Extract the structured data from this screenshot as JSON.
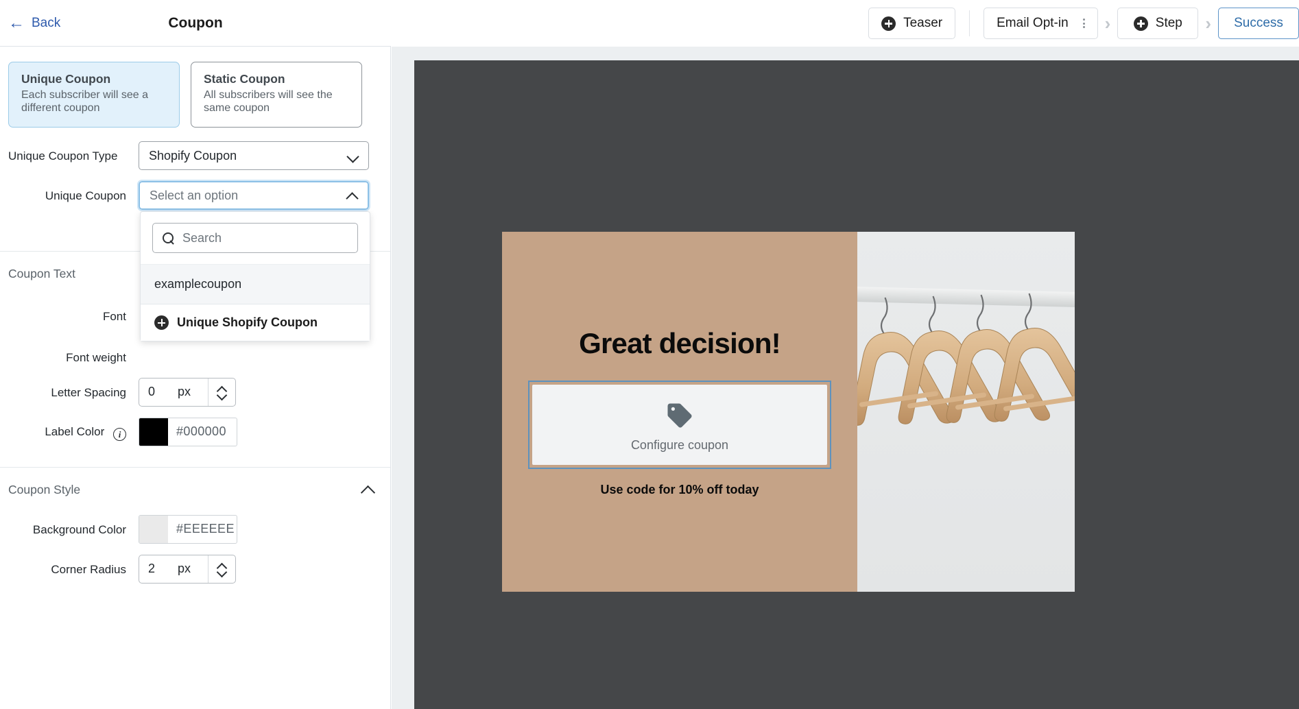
{
  "topbar": {
    "back_label": "Back",
    "panel_title": "Coupon",
    "steps": [
      {
        "label": "Teaser",
        "icon": "plus-circle-icon",
        "active": false,
        "kebab": false
      },
      {
        "label": "Email Opt-in",
        "icon": null,
        "active": false,
        "kebab": true
      },
      {
        "label": "Step",
        "icon": "plus-circle-icon",
        "active": false,
        "kebab": false
      },
      {
        "label": "Success",
        "icon": null,
        "active": true,
        "kebab": false
      }
    ]
  },
  "coupon_type": {
    "options": [
      {
        "title": "Unique Coupon",
        "desc": "Each subscriber will see a different coupon",
        "selected": true
      },
      {
        "title": "Static Coupon",
        "desc": "All subscribers will see the same coupon",
        "selected": false
      }
    ]
  },
  "fields": {
    "unique_coupon_type": {
      "label": "Unique Coupon Type",
      "value": "Shopify Coupon"
    },
    "unique_coupon": {
      "label": "Unique Coupon",
      "placeholder": "Select an option"
    }
  },
  "dropdown": {
    "search_placeholder": "Search",
    "search_icon": "search-icon",
    "options": [
      "examplecoupon"
    ],
    "action": {
      "label": "Unique Shopify Coupon",
      "icon": "plus-circle-icon"
    }
  },
  "coupon_text": {
    "section_title": "Coupon Text",
    "font_label": "Font",
    "font_weight_label": "Font weight",
    "letter_spacing": {
      "label": "Letter Spacing",
      "value": "0",
      "unit": "px"
    },
    "label_color": {
      "label": "Label Color",
      "hex": "#000000",
      "swatch": "#000000",
      "info_icon": "info-icon"
    }
  },
  "coupon_style": {
    "section_title": "Coupon Style",
    "background_color": {
      "label": "Background Color",
      "hex": "#EEEEEE",
      "swatch": "#EAEAEA"
    },
    "corner_radius": {
      "label": "Corner Radius",
      "value": "2",
      "unit": "px"
    }
  },
  "preview": {
    "headline": "Great decision!",
    "configure_text": "Configure coupon",
    "subtext": "Use code for 10% off today",
    "tag_icon": "tag-icon",
    "panel_bg": "#C5A387",
    "stage_bg": "#454749",
    "coupon_bg": "#F2F3F4"
  }
}
